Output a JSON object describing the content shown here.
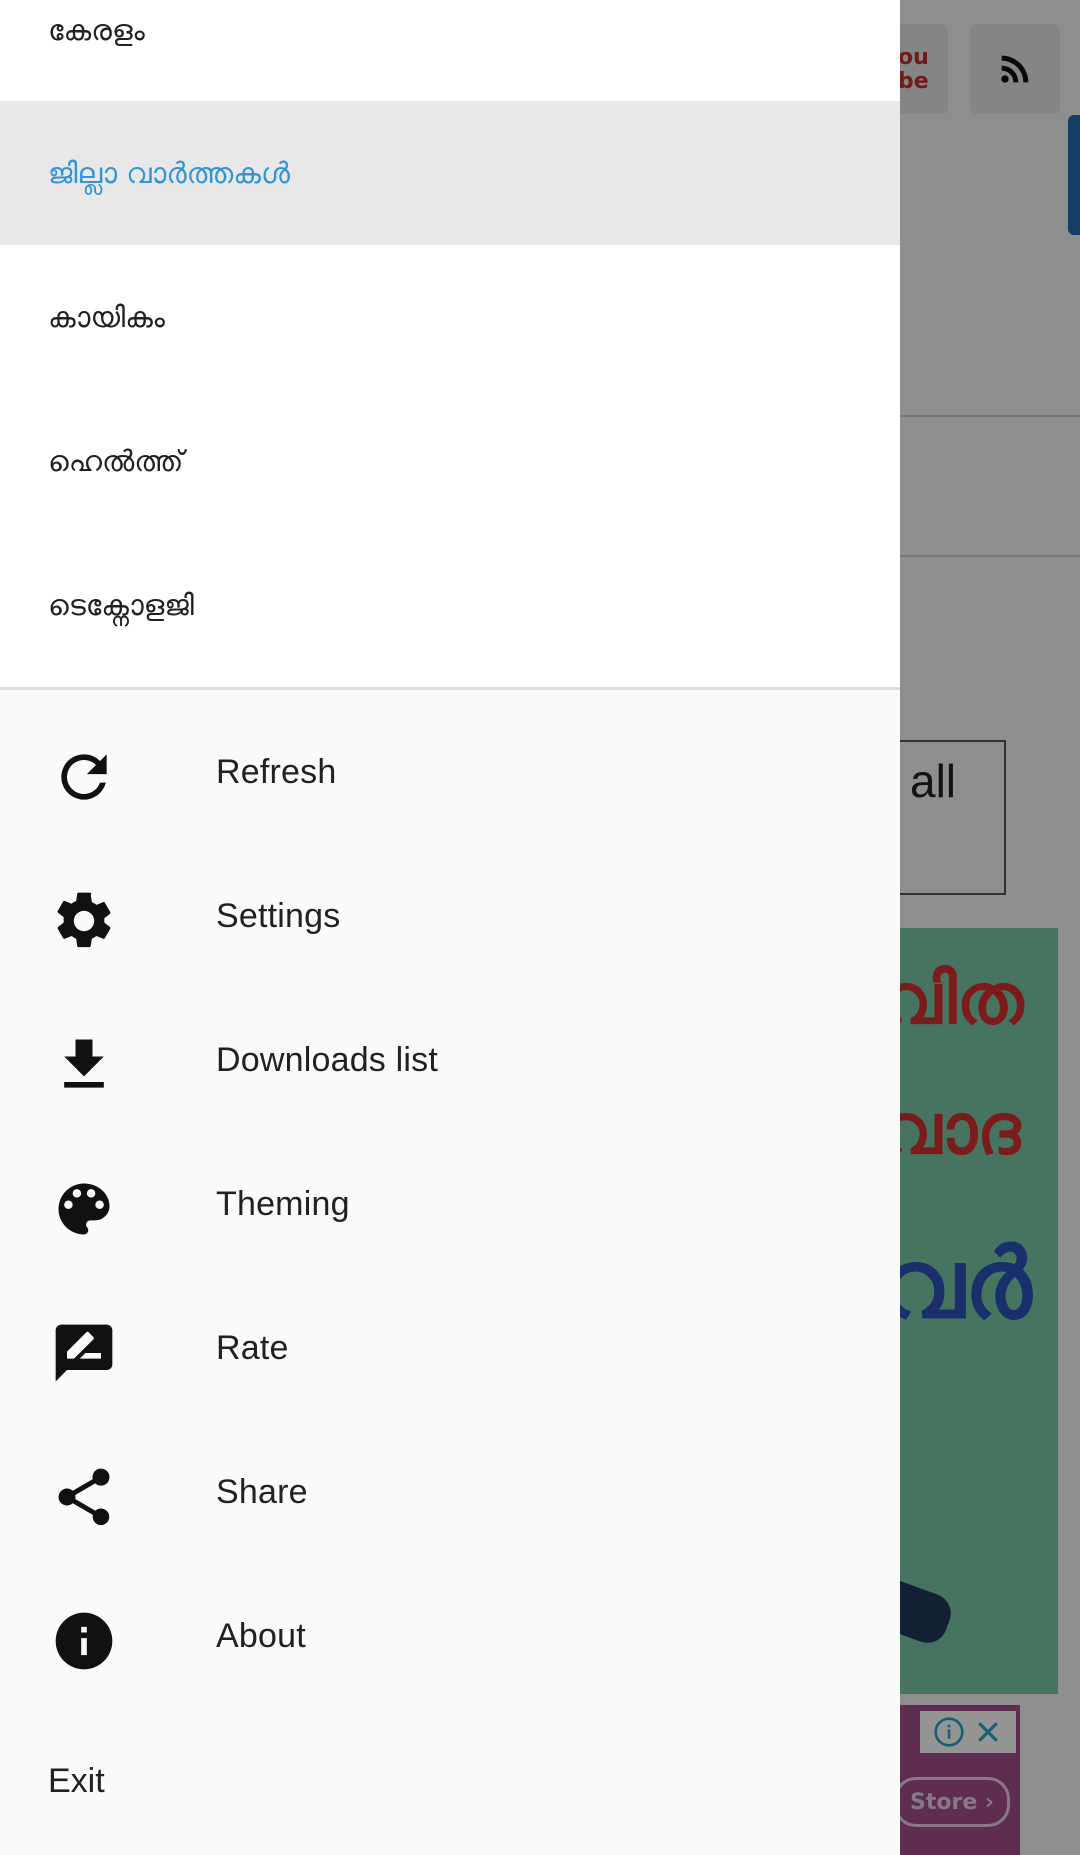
{
  "background": {
    "box_text": "all",
    "ad_line1": "വിത",
    "ad_line2": "വാദ",
    "ad_line3": "വർ",
    "store_label": "Store ›"
  },
  "drawer": {
    "categories": [
      {
        "label": "കേരളം"
      },
      {
        "label": "ജില്ലാ വാർത്തകൾ",
        "selected": true
      },
      {
        "label": "കായികം"
      },
      {
        "label": "ഹെൽത്ത്"
      },
      {
        "label": "ടെക്നോളജി"
      }
    ],
    "menu": [
      {
        "label": "Refresh",
        "icon": "refresh-icon"
      },
      {
        "label": "Settings",
        "icon": "gear-icon"
      },
      {
        "label": "Downloads list",
        "icon": "download-icon"
      },
      {
        "label": "Theming",
        "icon": "palette-icon"
      },
      {
        "label": "Rate",
        "icon": "rate-review-icon"
      },
      {
        "label": "Share",
        "icon": "share-icon"
      },
      {
        "label": "About",
        "icon": "info-icon"
      }
    ],
    "exit_label": "Exit"
  },
  "colors": {
    "selected_text": "#2f95d6",
    "selected_bg": "#e8e8e8",
    "drawer_bg": "#fafafa",
    "scrim": "rgba(0,0,0,0.42)"
  }
}
